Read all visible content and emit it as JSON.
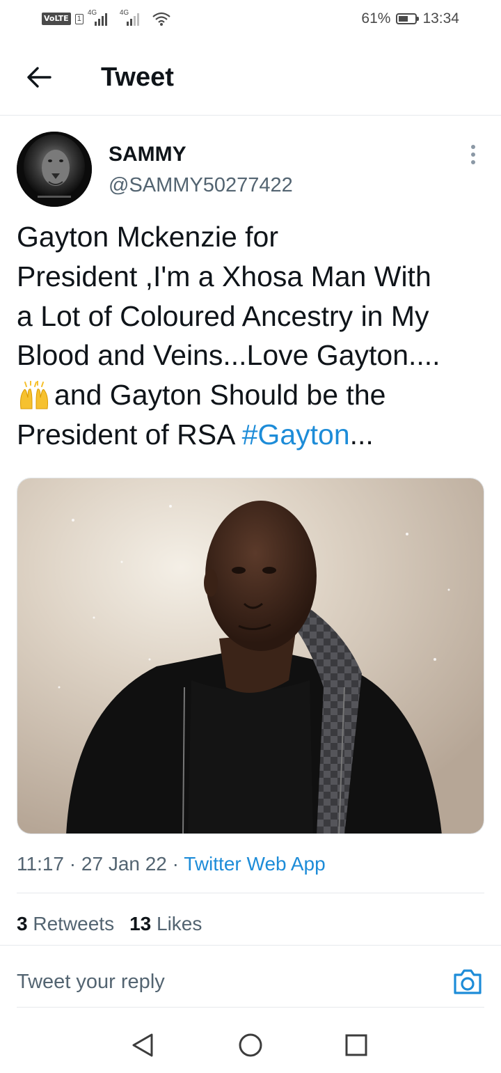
{
  "status_bar": {
    "volte": "VoLTE",
    "sim": "1",
    "network1": "4G",
    "network2": "4G",
    "battery": "61%",
    "battery_level": 0.61,
    "time": "13:34"
  },
  "header": {
    "back_icon": "arrow-left-icon",
    "title": "Tweet"
  },
  "tweet": {
    "author_name": "SAMMY",
    "author_handle": "@SAMMY50277422",
    "avatar_icon": "lion-avatar",
    "text_line1": "Gayton Mckenzie for",
    "text_line2": "President ,I'm a Xhosa Man With",
    "text_line3": "a Lot of Coloured Ancestry in My",
    "text_line4": "Blood and Veins...Love Gayton....",
    "emoji": "raising-hands-emoji",
    "text_line5": "and Gayton Should be the",
    "text_line6": "President of RSA ",
    "hashtag": "#Gayton",
    "ellipsis": "...",
    "time": "11:17",
    "separator": " · ",
    "date": "27 Jan 22",
    "source": "Twitter Web App",
    "retweets_count": "3",
    "retweets_label": "Retweets",
    "likes_count": "13",
    "likes_label": "Likes"
  },
  "reply": {
    "placeholder": "Tweet your reply",
    "camera_icon": "camera-icon"
  },
  "colors": {
    "link": "#1d8cd8",
    "text": "#0f1419",
    "secondary": "#536471",
    "divider": "#e6e9ec"
  },
  "nav": {
    "back": "nav-back-icon",
    "home": "nav-home-icon",
    "recents": "nav-recents-icon"
  }
}
